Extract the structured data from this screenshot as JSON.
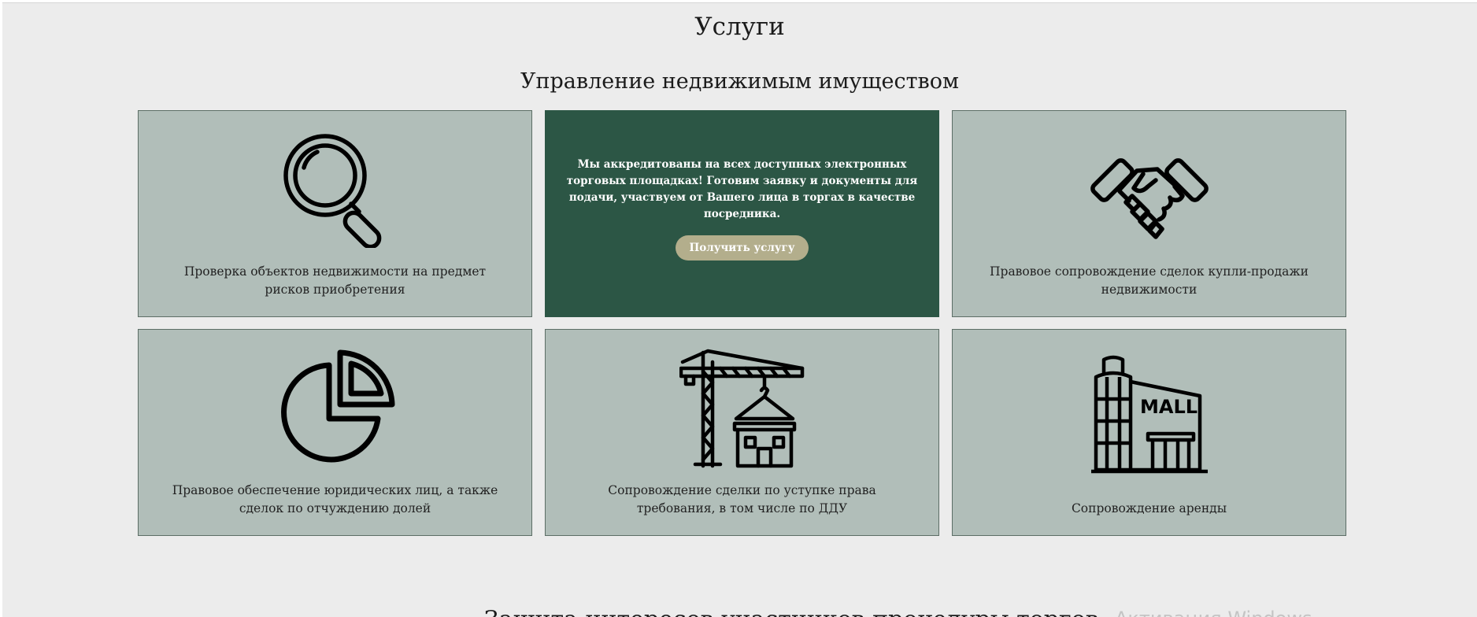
{
  "section": {
    "title": "Услуги",
    "subtitle": "Управление недвижимым имуществом"
  },
  "cards": [
    {
      "icon": "magnifier-icon",
      "label": "Проверка объектов недвижимости на предмет рисков приобретения"
    },
    {
      "icon": "",
      "promo_text": "Мы аккредитованы на всех доступных электронных торговых площадках! Готовим заявку и документы для подачи, участвуем от Вашего лица в торгах в качестве посредника.",
      "button_label": "Получить услугу"
    },
    {
      "icon": "handshake-icon",
      "label": "Правовое сопровождение сделок купли-продажи недвижимости"
    },
    {
      "icon": "pie-chart-icon",
      "label": "Правовое обеспечение юридических лиц, а также сделок по отчуждению долей"
    },
    {
      "icon": "construction-crane-icon",
      "label": "Сопровождение сделки по уступке права требования, в том числе по ДДУ"
    },
    {
      "icon": "mall-icon",
      "icon_text": "MALL",
      "label": "Сопровождение аренды"
    }
  ],
  "next_section": {
    "heading": "Защита интересов участников процедуры торгов"
  },
  "os_watermark": "Активация Windows",
  "colors": {
    "page_bg": "#ececec",
    "card_bg": "#b1beb9",
    "promo_bg": "#2c5645",
    "button_bg": "#b3ae8c"
  }
}
